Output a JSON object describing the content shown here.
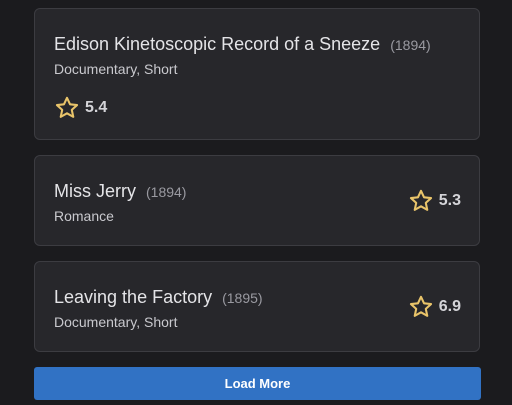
{
  "movies": [
    {
      "title": "Edison Kinetoscopic Record of a Sneeze",
      "year": "(1894)",
      "genres": "Documentary, Short",
      "rating": "5.4"
    },
    {
      "title": "Miss Jerry",
      "year": "(1894)",
      "genres": "Romance",
      "rating": "5.3"
    },
    {
      "title": "Leaving the Factory",
      "year": "(1895)",
      "genres": "Documentary, Short",
      "rating": "6.9"
    }
  ],
  "load_more_label": "Load More",
  "icons": {
    "rating": "star-icon"
  },
  "colors": {
    "star": "#e9c46a",
    "button": "#3172c4",
    "card": "#27272b",
    "background": "#1b1b1e"
  }
}
